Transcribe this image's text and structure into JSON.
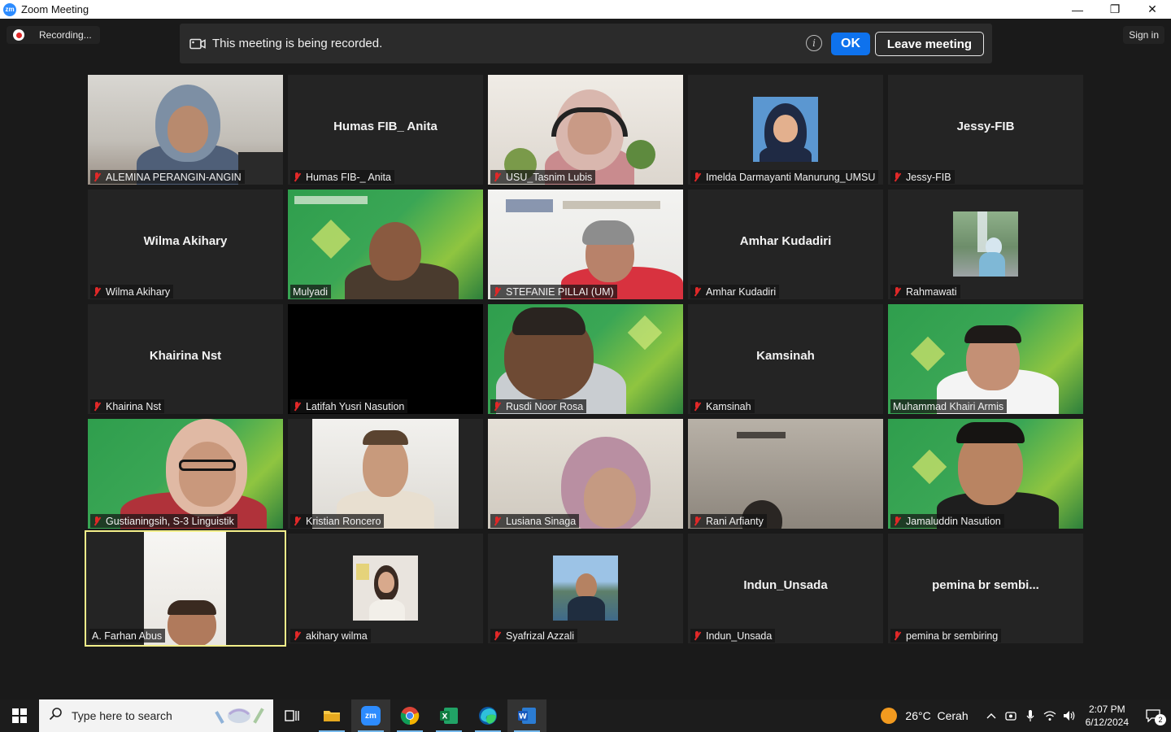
{
  "window": {
    "title": "Zoom Meeting",
    "logo_text": "zm",
    "minimize": "—",
    "restore": "❐",
    "close": "✕"
  },
  "recording": {
    "label": "Recording..."
  },
  "banner": {
    "message": "This meeting is being recorded.",
    "info": "i",
    "ok_label": "OK",
    "leave_label": "Leave meeting"
  },
  "signin": {
    "label": "Sign in"
  },
  "participants": [
    {
      "name": "ALEMINA PERANGIN-ANGIN",
      "muted": true,
      "display": "video"
    },
    {
      "name": "Humas FIB-_ Anita",
      "center": "Humas  FIB_  Anita",
      "muted": true,
      "display": "name"
    },
    {
      "name": "USU_Tasnim Lubis",
      "muted": true,
      "display": "video"
    },
    {
      "name": "Imelda Darmayanti Manurung_UMSU",
      "muted": true,
      "display": "avatar"
    },
    {
      "name": "Jessy-FIB",
      "center": "Jessy-FIB",
      "muted": true,
      "display": "name"
    },
    {
      "name": "Wilma Akihary",
      "center": "Wilma Akihary",
      "muted": true,
      "display": "name"
    },
    {
      "name": "Mulyadi",
      "muted": false,
      "display": "video"
    },
    {
      "name": "STEFANIE PILLAI (UM)",
      "muted": true,
      "display": "video"
    },
    {
      "name": "Amhar Kudadiri",
      "center": "Amhar Kudadiri",
      "muted": true,
      "display": "name"
    },
    {
      "name": "Rahmawati",
      "muted": true,
      "display": "avatar"
    },
    {
      "name": "Khairina Nst",
      "center": "Khairina Nst",
      "muted": true,
      "display": "name"
    },
    {
      "name": "Latifah Yusri Nasution",
      "muted": true,
      "display": "video"
    },
    {
      "name": "Rusdi Noor Rosa",
      "muted": true,
      "display": "video"
    },
    {
      "name": "Kamsinah",
      "center": "Kamsinah",
      "muted": true,
      "display": "name"
    },
    {
      "name": "Muhammad Khairi Armis",
      "muted": false,
      "display": "video"
    },
    {
      "name": "Gustianingsih, S-3 Linguistik",
      "muted": true,
      "display": "video"
    },
    {
      "name": "Kristian Roncero",
      "muted": true,
      "display": "video"
    },
    {
      "name": "Lusiana Sinaga",
      "muted": true,
      "display": "video"
    },
    {
      "name": "Rani Arfianty",
      "muted": true,
      "display": "video"
    },
    {
      "name": "Jamaluddin Nasution",
      "muted": true,
      "display": "video"
    },
    {
      "name": "A. Farhan Abus",
      "muted": false,
      "display": "video",
      "active": true
    },
    {
      "name": "akihary wilma",
      "muted": true,
      "display": "avatar"
    },
    {
      "name": "Syafrizal Azzali",
      "muted": true,
      "display": "avatar"
    },
    {
      "name": "Indun_Unsada",
      "center": "Indun_Unsada",
      "muted": true,
      "display": "name"
    },
    {
      "name": "pemina br sembiring",
      "center": "pemina br sembi...",
      "muted": true,
      "display": "name"
    }
  ],
  "taskbar": {
    "search_placeholder": "Type here to search",
    "apps": [
      "task-view",
      "file-explorer",
      "zoom",
      "chrome",
      "excel",
      "edge",
      "word"
    ],
    "weather": {
      "temp": "26°C",
      "condition": "Cerah"
    },
    "clock": {
      "time": "2:07 PM",
      "date": "6/12/2024"
    },
    "notifications": "2"
  }
}
